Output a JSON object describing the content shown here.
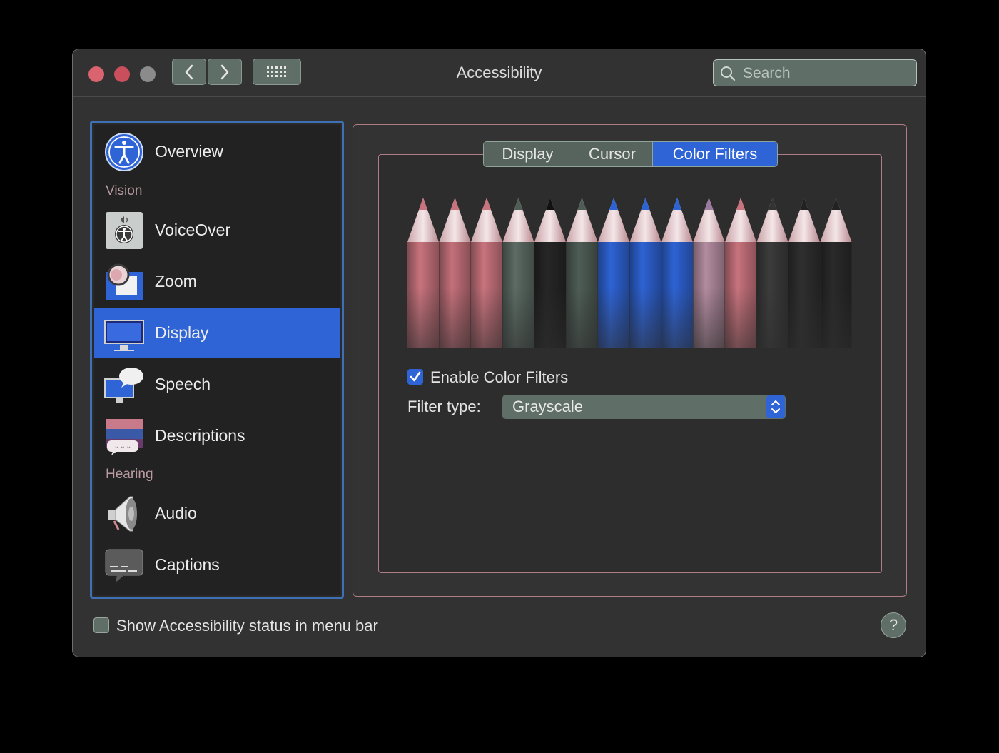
{
  "window": {
    "title": "Accessibility",
    "colors": {
      "close": "#d9646f",
      "minimize": "#c94f5d",
      "zoom": "#8b8b8b",
      "accent": "#2f64d6"
    }
  },
  "toolbar": {
    "back_icon": "chevron-left-icon",
    "forward_icon": "chevron-right-icon",
    "grid_icon": "grid-icon"
  },
  "search": {
    "placeholder": "Search",
    "icon": "search-icon"
  },
  "sidebar": {
    "items": [
      {
        "label": "Overview",
        "icon": "accessibility-icon"
      },
      {
        "section": "Vision"
      },
      {
        "label": "VoiceOver",
        "icon": "voiceover-icon"
      },
      {
        "label": "Zoom",
        "icon": "zoom-icon"
      },
      {
        "label": "Display",
        "icon": "display-icon",
        "selected": true
      },
      {
        "label": "Speech",
        "icon": "speech-icon"
      },
      {
        "label": "Descriptions",
        "icon": "descriptions-icon"
      },
      {
        "section": "Hearing"
      },
      {
        "label": "Audio",
        "icon": "speaker-icon"
      },
      {
        "label": "Captions",
        "icon": "captions-icon"
      }
    ]
  },
  "tabs": [
    {
      "label": "Display"
    },
    {
      "label": "Cursor"
    },
    {
      "label": "Color Filters",
      "active": true
    }
  ],
  "color_filters": {
    "enable_label": "Enable Color Filters",
    "enabled": true,
    "filter_type_label": "Filter type:",
    "filter_type_value": "Grayscale"
  },
  "footer": {
    "status_checkbox_label": "Show Accessibility status in menu bar",
    "status_checked": false,
    "help_label": "?"
  }
}
